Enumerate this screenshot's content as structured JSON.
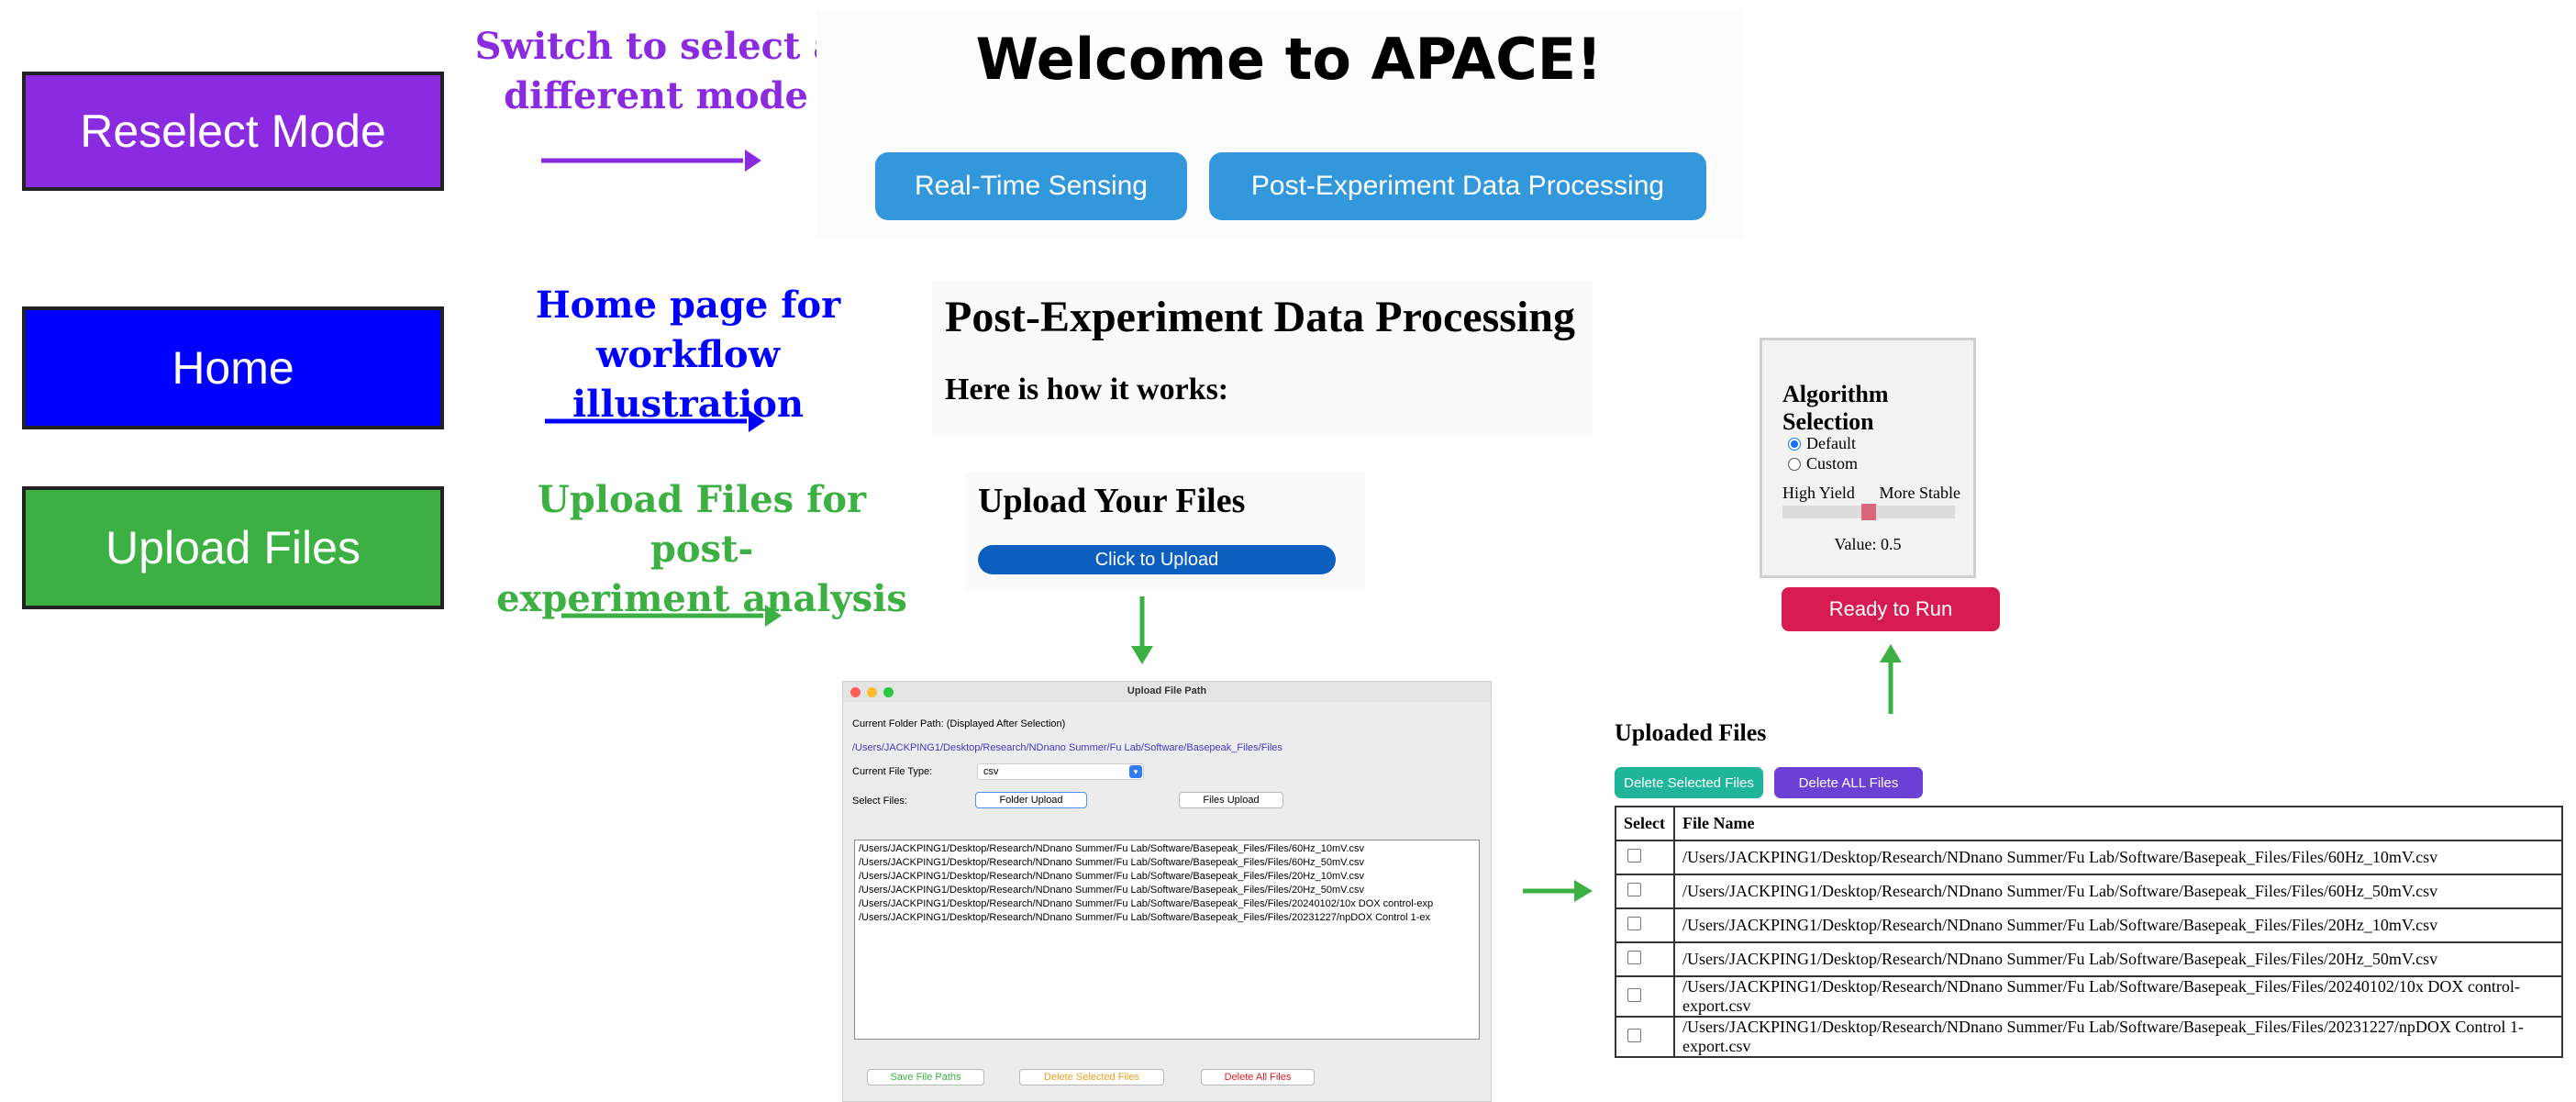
{
  "modes": {
    "reselect": {
      "label": "Reselect Mode",
      "color": "#8a2be2"
    },
    "home": {
      "label": "Home",
      "color": "#0000ff"
    },
    "upload": {
      "label": "Upload Files",
      "color": "#3cb043"
    }
  },
  "annotations": {
    "reselect_line1": "Switch to select a",
    "reselect_line2": "different mode",
    "home_line1": "Home page for",
    "home_line2": "workflow illustration",
    "upload_line1": "Upload Files for post-",
    "upload_line2": "experiment analysis"
  },
  "welcome": {
    "title": "Welcome to APACE!",
    "btn_realtime": "Real-Time Sensing",
    "btn_post": "Post-Experiment Data Processing"
  },
  "post": {
    "title": "Post-Experiment Data Processing",
    "subtitle": "Here is how it works:"
  },
  "upload_panel": {
    "title": "Upload Your Files",
    "button": "Click to Upload"
  },
  "algorithm": {
    "title": "Algorithm Selection",
    "options": [
      "Default",
      "Custom"
    ],
    "selected": "Default",
    "slider_left": "High Yield",
    "slider_right": "More Stable",
    "slider_value": 0.5,
    "value_text": "Value: 0.5",
    "run_button": "Ready to Run"
  },
  "dialog": {
    "window_title": "Upload File Path",
    "folder_label": "Current Folder Path: (Displayed After Selection)",
    "folder_path": "/Users/JACKPING1/Desktop/Research/NDnano Summer/Fu Lab/Software/Basepeak_Files/Files",
    "file_type_label": "Current File Type:",
    "file_type_value": "csv",
    "select_label": "Select Files:",
    "folder_upload": "Folder Upload",
    "files_upload": "Files Upload",
    "paths": [
      "/Users/JACKPING1/Desktop/Research/NDnano Summer/Fu Lab/Software/Basepeak_Files/Files/60Hz_10mV.csv",
      "/Users/JACKPING1/Desktop/Research/NDnano Summer/Fu Lab/Software/Basepeak_Files/Files/60Hz_50mV.csv",
      "/Users/JACKPING1/Desktop/Research/NDnano Summer/Fu Lab/Software/Basepeak_Files/Files/20Hz_10mV.csv",
      "/Users/JACKPING1/Desktop/Research/NDnano Summer/Fu Lab/Software/Basepeak_Files/Files/20Hz_50mV.csv",
      "/Users/JACKPING1/Desktop/Research/NDnano Summer/Fu Lab/Software/Basepeak_Files/Files/20240102/10x DOX control-exp",
      "/Users/JACKPING1/Desktop/Research/NDnano Summer/Fu Lab/Software/Basepeak_Files/Files/20231227/npDOX Control 1-ex"
    ],
    "save_btn": "Save File Paths",
    "delete_selected_btn": "Delete Selected Files",
    "delete_all_btn": "Delete All Files"
  },
  "uploaded": {
    "title": "Uploaded Files",
    "delete_selected": "Delete Selected Files",
    "delete_all": "Delete ALL Files",
    "col_select": "Select",
    "col_name": "File Name",
    "rows": [
      "/Users/JACKPING1/Desktop/Research/NDnano Summer/Fu Lab/Software/Basepeak_Files/Files/60Hz_10mV.csv",
      "/Users/JACKPING1/Desktop/Research/NDnano Summer/Fu Lab/Software/Basepeak_Files/Files/60Hz_50mV.csv",
      "/Users/JACKPING1/Desktop/Research/NDnano Summer/Fu Lab/Software/Basepeak_Files/Files/20Hz_10mV.csv",
      "/Users/JACKPING1/Desktop/Research/NDnano Summer/Fu Lab/Software/Basepeak_Files/Files/20Hz_50mV.csv",
      "/Users/JACKPING1/Desktop/Research/NDnano Summer/Fu Lab/Software/Basepeak_Files/Files/20240102/10x DOX control-export.csv",
      "/Users/JACKPING1/Desktop/Research/NDnano Summer/Fu Lab/Software/Basepeak_Files/Files/20231227/npDOX Control 1-export.csv"
    ]
  }
}
